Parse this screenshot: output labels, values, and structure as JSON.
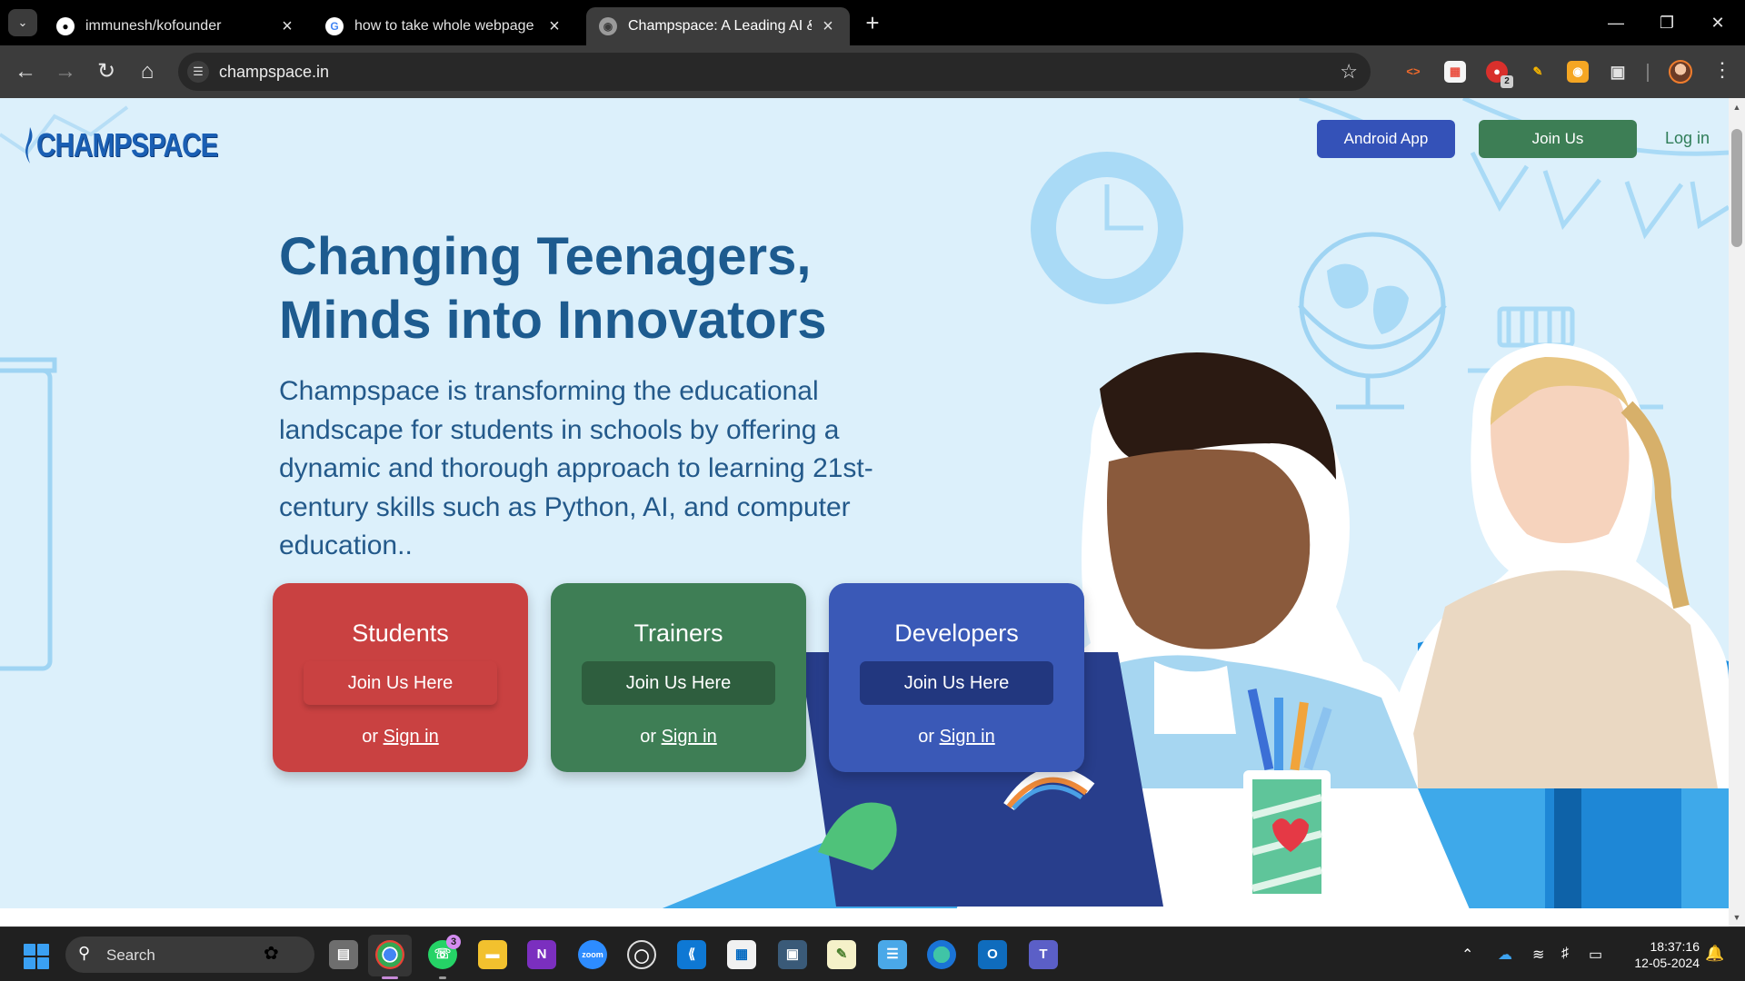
{
  "browser": {
    "tabs": [
      {
        "title": "immunesh/kofounder",
        "favicon": "github-icon",
        "active": false
      },
      {
        "title": "how to take whole webpage sc",
        "favicon": "google-icon",
        "active": false
      },
      {
        "title": "Champspace: A Leading AI & Py",
        "favicon": "globe-icon",
        "active": true
      }
    ],
    "url": "champspace.in",
    "extensions": [
      {
        "name": "code-icon"
      },
      {
        "name": "calendar-icon"
      },
      {
        "name": "pdf-icon",
        "badge": "2"
      },
      {
        "name": "pen-icon"
      },
      {
        "name": "screenshot-icon"
      },
      {
        "name": "puzzle-icon"
      }
    ]
  },
  "page": {
    "logo_text": "CHAMPSPACE",
    "nav": {
      "android_app": "Android App",
      "join_us": "Join Us",
      "log_in": "Log in"
    },
    "hero": {
      "title_line1": "Changing Teenagers,",
      "title_line2": "Minds into Innovators",
      "description": "Champspace is transforming the educational landscape for students in schools by offering a dynamic and thorough approach to learning 21st-century skills such as Python, AI, and computer education.."
    },
    "cards": [
      {
        "title": "Students",
        "join": "Join Us Here",
        "or": "or",
        "signin": "Sign in",
        "color": "#c94141"
      },
      {
        "title": "Trainers",
        "join": "Join Us Here",
        "or": "or",
        "signin": "Sign in",
        "color": "#3e7e55"
      },
      {
        "title": "Developers",
        "join": "Join Us Here",
        "or": "or",
        "signin": "Sign in",
        "color": "#3a59b7"
      }
    ],
    "colors": {
      "background": "#dcf0fb",
      "heading": "#1d5b8f",
      "accent_blue": "#3452b8",
      "accent_green": "#3d7e55"
    }
  },
  "taskbar": {
    "search_label": "Search",
    "whatsapp_badge": "3",
    "apps": [
      "file-explorer-icon",
      "chrome-icon",
      "whatsapp-icon",
      "folder-icon",
      "onenote-icon",
      "zoom-icon",
      "obs-icon",
      "vscode-icon",
      "store-icon",
      "photos-icon",
      "notepad-icon",
      "notes-icon",
      "edge-icon",
      "outlook-icon",
      "teams-icon"
    ],
    "time": "18:37:16",
    "date": "12-05-2024"
  }
}
